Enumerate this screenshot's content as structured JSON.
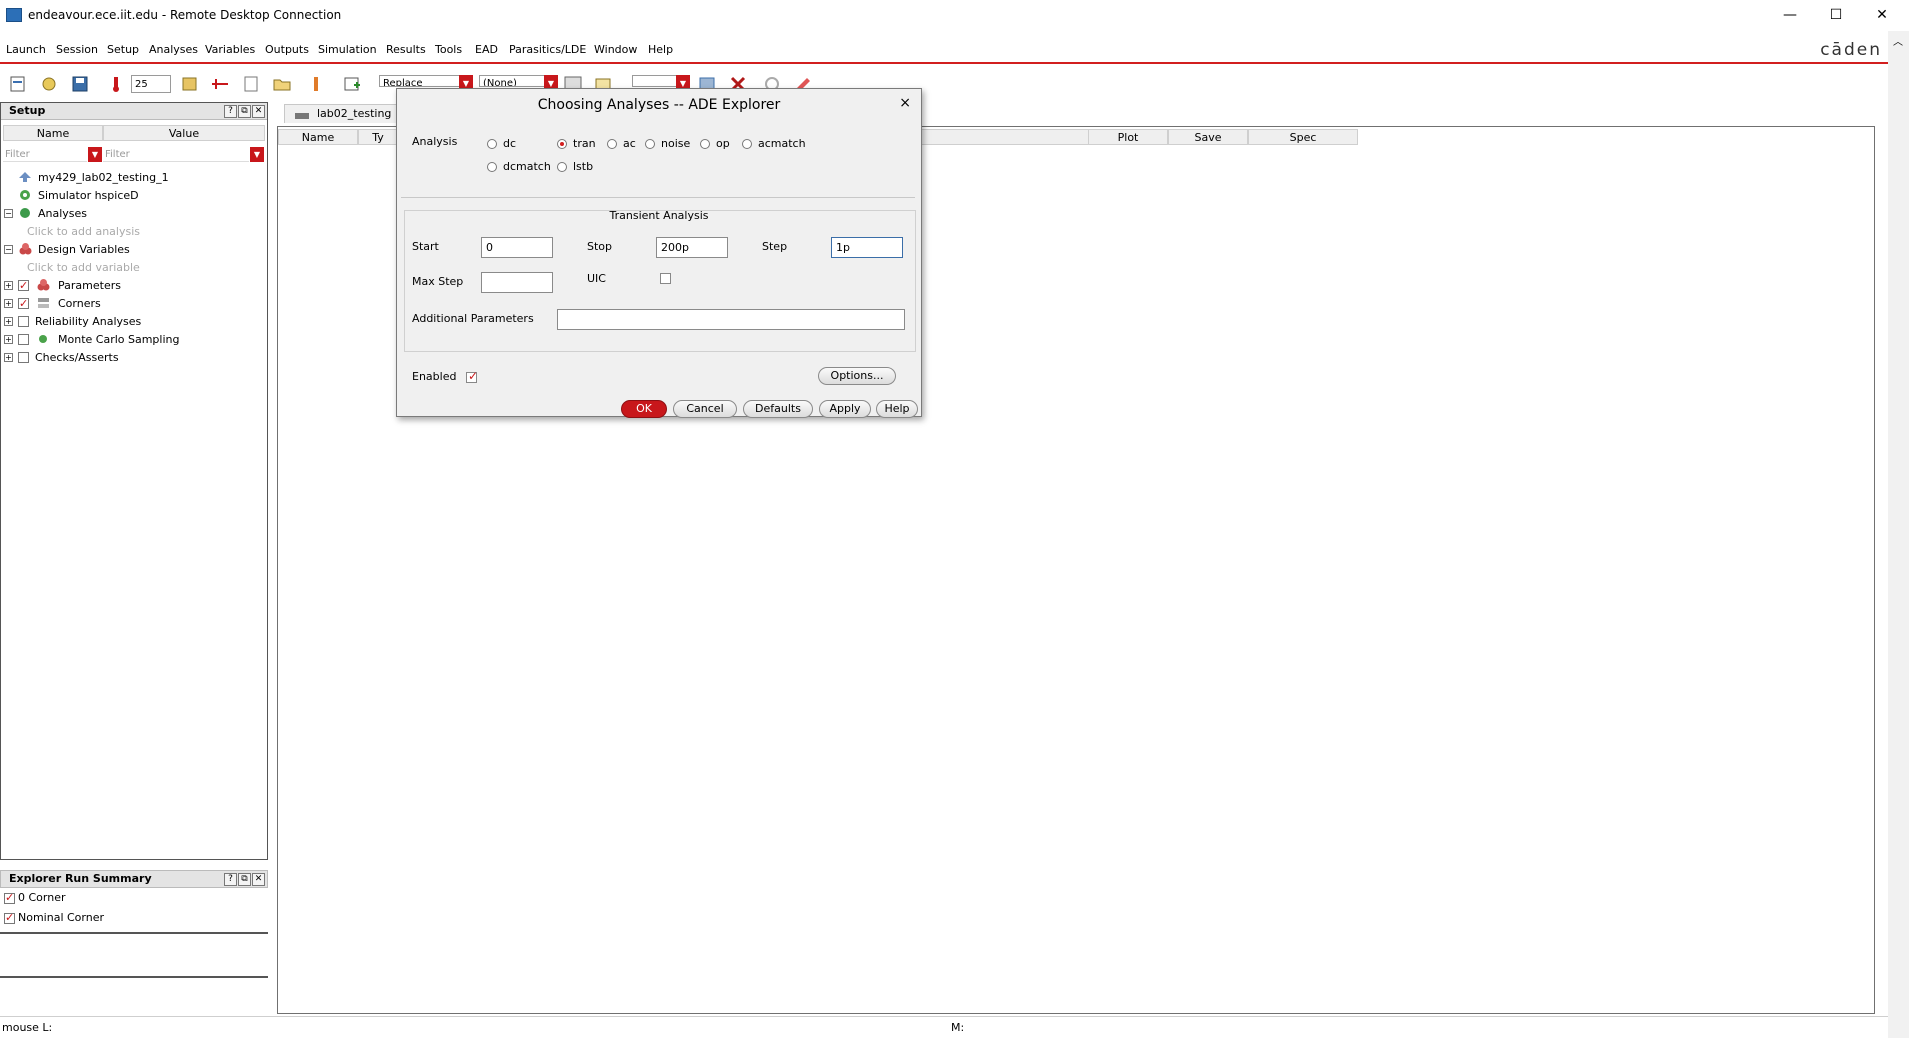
{
  "window": {
    "title": "endeavour.ece.iit.edu - Remote Desktop Connection",
    "minimize": "—",
    "maximize": "☐",
    "close": "✕"
  },
  "menubar": {
    "items": [
      "Launch",
      "Session",
      "Setup",
      "Analyses",
      "Variables",
      "Outputs",
      "Simulation",
      "Results",
      "Tools",
      "EAD",
      "Parasitics/LDE",
      "Window",
      "Help"
    ],
    "brand": "cāden"
  },
  "toolbar": {
    "temperature": "25",
    "mode_select": "Replace",
    "corner_select": "(None)"
  },
  "setup_panel": {
    "title": "Setup",
    "col_name": "Name",
    "col_value": "Value",
    "filter_placeholder": "Filter",
    "tree": [
      {
        "label": "my429_lab02_testing_1"
      },
      {
        "label": "Simulator  hspiceD"
      },
      {
        "label": "Analyses"
      },
      {
        "label": "Click to add analysis"
      },
      {
        "label": "Design Variables"
      },
      {
        "label": "Click to add variable"
      },
      {
        "label": "Parameters"
      },
      {
        "label": "Corners"
      },
      {
        "label": "Reliability Analyses"
      },
      {
        "label": "Monte Carlo Sampling"
      },
      {
        "label": "Checks/Asserts"
      }
    ]
  },
  "summary_panel": {
    "title": "Explorer Run Summary",
    "rows": [
      "0 Corner",
      "Nominal Corner"
    ]
  },
  "main": {
    "tab": "lab02_testing",
    "columns": [
      "Name",
      "Ty",
      "Plot",
      "Save",
      "Spec"
    ]
  },
  "status": {
    "left": "mouse L:",
    "middle": "M:"
  },
  "dialog": {
    "title": "Choosing Analyses -- ADE Explorer",
    "close": "×",
    "analysis_label": "Analysis",
    "analyses": [
      "dc",
      "tran",
      "ac",
      "noise",
      "op",
      "acmatch",
      "dcmatch",
      "lstb"
    ],
    "selected": "tran",
    "section_title": "Transient Analysis",
    "start_label": "Start",
    "start_value": "0",
    "stop_label": "Stop",
    "stop_value": "200p",
    "step_label": "Step",
    "step_value": "1p",
    "maxstep_label": "Max Step",
    "maxstep_value": "",
    "uic_label": "UIC",
    "additional_label": "Additional Parameters",
    "additional_value": "",
    "enabled_label": "Enabled",
    "options_button": "Options...",
    "ok_button": "OK",
    "cancel_button": "Cancel",
    "defaults_button": "Defaults",
    "apply_button": "Apply",
    "help_button": "Help"
  }
}
